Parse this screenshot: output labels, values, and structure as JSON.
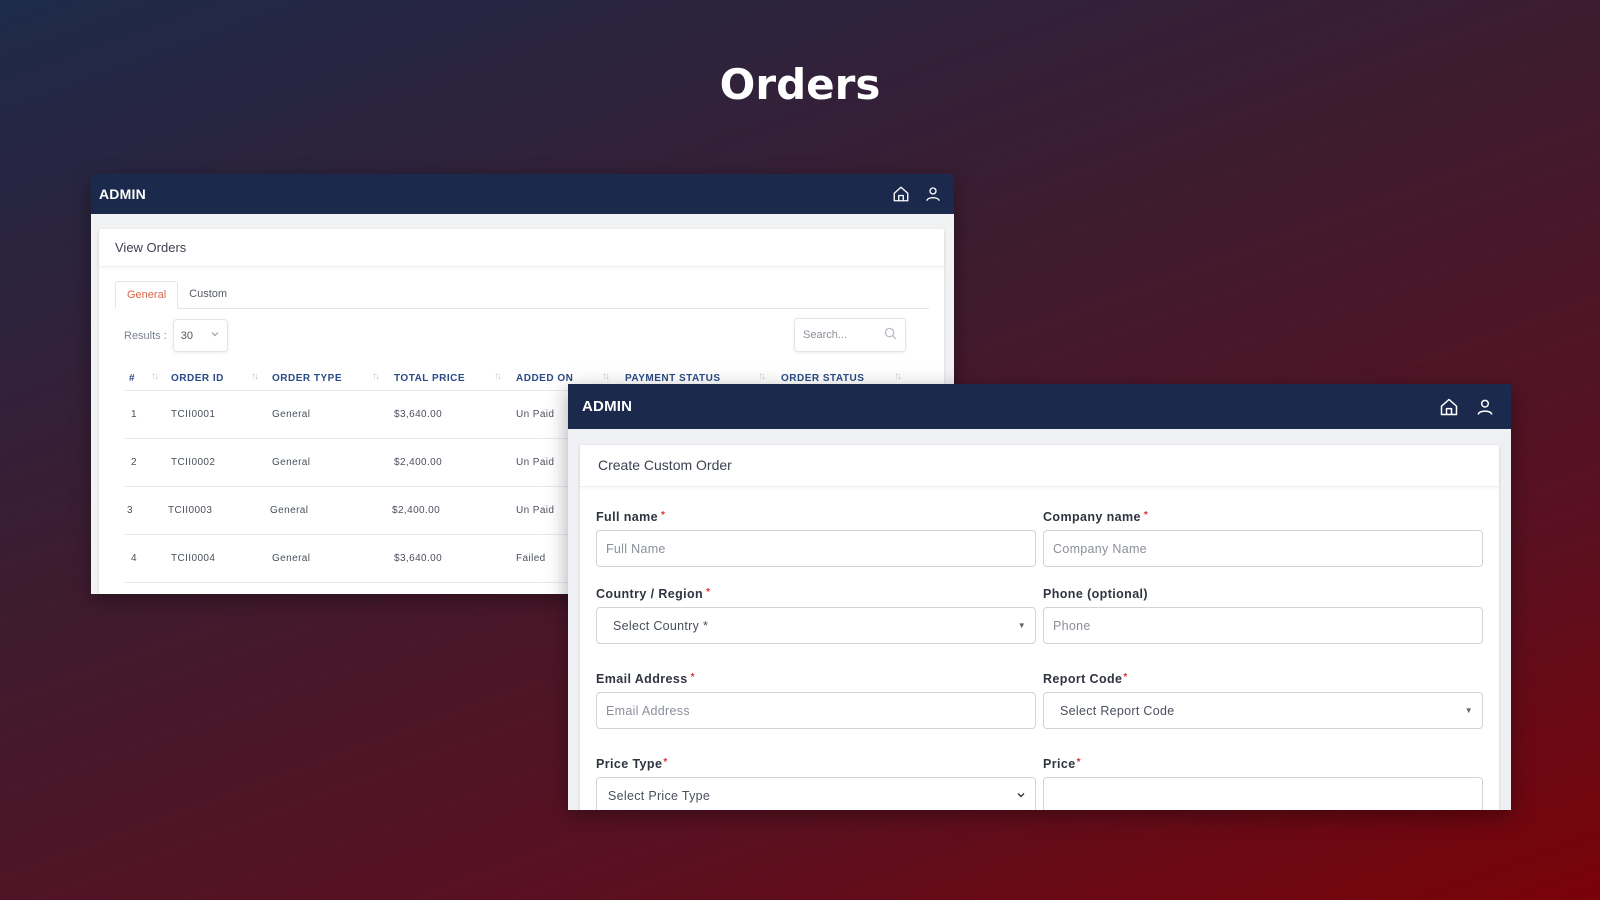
{
  "page_title": "Orders",
  "view_orders_window": {
    "brand": "ADMIN",
    "card_title": "View Orders",
    "tabs": [
      {
        "label": "General",
        "active": true
      },
      {
        "label": "Custom",
        "active": false
      }
    ],
    "results_label": "Results :",
    "results_value": "30",
    "search_placeholder": "Search...",
    "columns": [
      "#",
      "ORDER ID",
      "ORDER TYPE",
      "TOTAL PRICE",
      "ADDED ON",
      "PAYMENT STATUS",
      "ORDER STATUS"
    ],
    "rows": [
      {
        "num": "1",
        "order_id": "TCII0001",
        "order_type": "General",
        "total_price": "$3,640.00",
        "status": "Un Paid"
      },
      {
        "num": "2",
        "order_id": "TCII0002",
        "order_type": "General",
        "total_price": "$2,400.00",
        "status": "Un Paid"
      },
      {
        "num": "3",
        "order_id": "TCII0003",
        "order_type": "General",
        "total_price": "$2,400.00",
        "status": "Un Paid"
      },
      {
        "num": "4",
        "order_id": "TCII0004",
        "order_type": "General",
        "total_price": "$3,640.00",
        "status": "Failed"
      }
    ],
    "icons": [
      "home-icon",
      "user-icon",
      "search-icon",
      "chevron-down-icon",
      "sort-icon"
    ]
  },
  "custom_order_window": {
    "brand": "ADMIN",
    "card_title": "Create Custom Order",
    "fields": {
      "full_name": {
        "label": "Full name",
        "required_mark": "*",
        "placeholder": "Full Name"
      },
      "company_name": {
        "label": "Company name",
        "required_mark": "*",
        "placeholder": "Company Name"
      },
      "country": {
        "label": "Country / Region",
        "required_mark": "*",
        "selected": "Select Country *"
      },
      "phone": {
        "label": "Phone (optional)",
        "placeholder": "Phone"
      },
      "email": {
        "label": "Email Address",
        "required_mark": "*",
        "placeholder": "Email Address"
      },
      "report_code": {
        "label": "Report Code",
        "required_mark": "*",
        "selected": "Select Report Code"
      },
      "price_type": {
        "label": "Price Type",
        "required_mark": "*",
        "selected": "Select Price Type"
      },
      "price": {
        "label": "Price",
        "required_mark": "*",
        "value": ""
      }
    }
  },
  "colors": {
    "topbar": "#1b2a4c",
    "header_text": "#2c4a86",
    "active_tab": "#d9654a",
    "required": "#e0303a"
  }
}
